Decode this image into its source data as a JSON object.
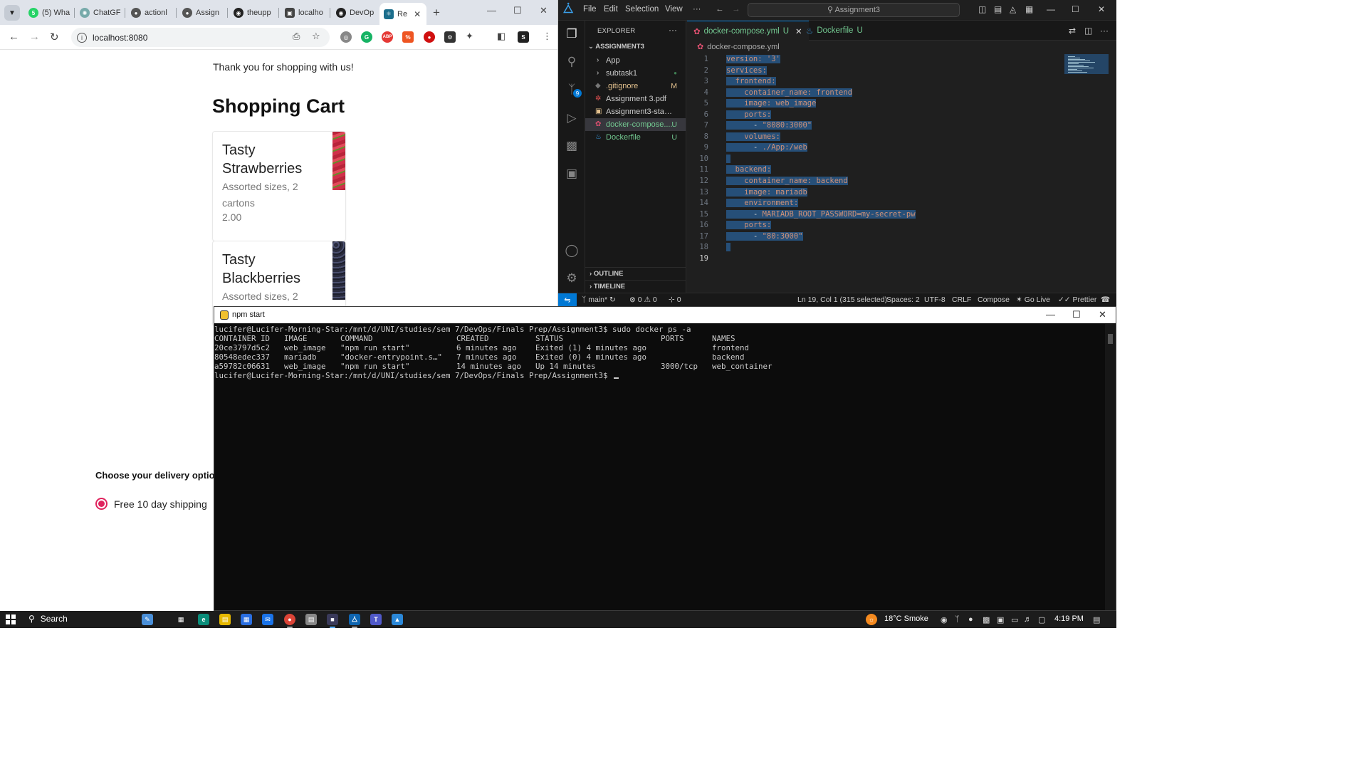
{
  "colors": {
    "vscode_accent": "#0078d4",
    "radio_accent": "#e0245e",
    "terminal_bg": "#0c0c0c"
  },
  "browser": {
    "tabs": [
      {
        "label": "(5) Wha",
        "icon": "whatsapp-icon",
        "color": "#25d366",
        "glyph": "5"
      },
      {
        "label": "ChatGF",
        "icon": "chatgpt-icon",
        "color": "#7aa",
        "glyph": "✺"
      },
      {
        "label": "actionl",
        "icon": "globe-icon",
        "color": "#555",
        "glyph": "●"
      },
      {
        "label": "Assign",
        "icon": "globe-icon",
        "color": "#555",
        "glyph": "●"
      },
      {
        "label": "theupp",
        "icon": "github-icon",
        "color": "#222",
        "glyph": "◉"
      },
      {
        "label": "localho",
        "icon": "localhost-icon",
        "color": "#444",
        "glyph": "▣"
      },
      {
        "label": "DevOp",
        "icon": "github-icon",
        "color": "#222",
        "glyph": "◉"
      },
      {
        "label": "Re",
        "icon": "react-icon",
        "color": "#1c6e8c",
        "glyph": "⚛"
      }
    ],
    "url": "localhost:8080"
  },
  "webpage": {
    "thank_you": "Thank you for shopping with us!",
    "cart_title": "Shopping Cart",
    "items": [
      {
        "name": "Tasty Strawberries",
        "description": "Assorted sizes, 2 cartons",
        "price": "2.00"
      },
      {
        "name": "Tasty Blackberries",
        "description": "Assorted sizes, 2"
      }
    ],
    "delivery_title": "Choose your delivery optio",
    "delivery_option": "Free 10 day shipping"
  },
  "vscode": {
    "menu": [
      "File",
      "Edit",
      "Selection",
      "View",
      "···"
    ],
    "search": "Assignment3",
    "explorer_title": "EXPLORER",
    "root": "ASSIGNMENT3",
    "tree": [
      {
        "label": "App",
        "status": ""
      },
      {
        "label": "subtask1",
        "status": "●"
      },
      {
        "label": ".gitignore",
        "status": "M"
      },
      {
        "label": "Assignment 3.pdf",
        "status": ""
      },
      {
        "label": "Assignment3-staging-...",
        "status": ""
      },
      {
        "label": "docker-compose....",
        "status": "U"
      },
      {
        "label": "Dockerfile",
        "status": "U"
      }
    ],
    "outline": "OUTLINE",
    "timeline": "TIMELINE",
    "tabs": [
      {
        "label": "docker-compose.yml",
        "status": "U"
      },
      {
        "label": "Dockerfile",
        "status": "U"
      }
    ],
    "breadcrumb": "docker-compose.yml",
    "scm_badge": "9",
    "status": {
      "branch": "main*",
      "errors": "0",
      "warnings": "0",
      "ports": "0",
      "position": "Ln 19, Col 1 (315 selected)",
      "spaces": "Spaces: 2",
      "encoding": "UTF-8",
      "eol": "CRLF",
      "language": "Compose",
      "golive": "Go Live",
      "prettier": "Prettier"
    }
  },
  "code_lines": [
    "version: '3'",
    "services:",
    "  frontend:",
    "    container_name: frontend",
    "    image: web_image",
    "    ports:",
    "      - \"8080:3000\"",
    "    volumes:",
    "      - ./App:/web",
    "",
    "  backend:",
    "    container_name: backend",
    "    image: mariadb",
    "    environment:",
    "      - MARIADB_ROOT_PASSWORD=my-secret-pw",
    "    ports:",
    "      - \"80:3000\"",
    "",
    ""
  ],
  "terminal": {
    "title": "npm start",
    "command_line": "lucifer@Lucifer-Morning-Star:/mnt/d/UNI/studies/sem 7/DevOps/Finals Prep/Assignment3$ sudo docker ps -a",
    "headers": [
      "CONTAINER ID",
      "IMAGE",
      "COMMAND",
      "CREATED",
      "STATUS",
      "PORTS",
      "NAMES"
    ],
    "rows": [
      [
        "20ce3797d5c2",
        "web_image",
        "\"npm run start\"",
        "6 minutes ago",
        "Exited (1) 4 minutes ago",
        "",
        "frontend"
      ],
      [
        "80548edec337",
        "mariadb",
        "\"docker-entrypoint.s…\"",
        "7 minutes ago",
        "Exited (0) 4 minutes ago",
        "",
        "backend"
      ],
      [
        "a59782c06631",
        "web_image",
        "\"npm run start\"",
        "14 minutes ago",
        "Up 14 minutes",
        "3000/tcp",
        "web_container"
      ]
    ],
    "prompt": "lucifer@Lucifer-Morning-Star:/mnt/d/UNI/studies/sem 7/DevOps/Finals Prep/Assignment3$"
  },
  "taskbar": {
    "search": "Search",
    "weather": "18°C  Smoke",
    "time": "4:19 PM"
  }
}
